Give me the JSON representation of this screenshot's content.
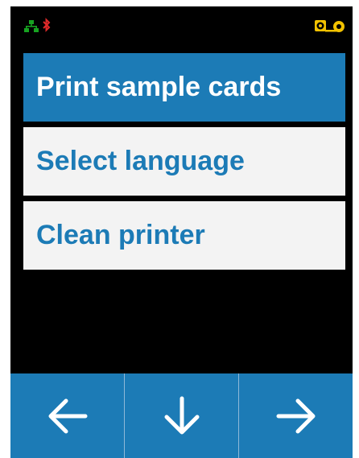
{
  "status": {
    "icons": [
      "network-icon",
      "bluetooth-icon",
      "ribbon-icon"
    ],
    "colors": {
      "network": "#17a321",
      "bluetooth": "#e02a2a",
      "ribbon": "#f2c200"
    }
  },
  "menu": {
    "items": [
      {
        "label": "Print sample cards",
        "selected": true
      },
      {
        "label": "Select language",
        "selected": false
      },
      {
        "label": "Clean printer",
        "selected": false
      }
    ]
  },
  "nav": {
    "buttons": [
      "arrow-left-icon",
      "arrow-down-icon",
      "arrow-right-icon"
    ]
  },
  "colors": {
    "accent": "#1c7bb6",
    "item_background": "#f3f3f3",
    "screen_background": "#000000"
  }
}
